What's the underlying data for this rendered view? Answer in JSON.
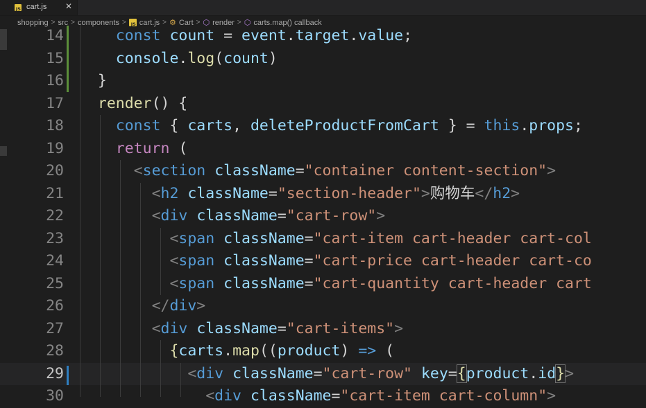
{
  "tab": {
    "badge": "JS",
    "label": "cart.js",
    "close": "✕"
  },
  "breadcrumb": {
    "items": [
      "shopping",
      "src",
      "components",
      "cart.js",
      "Cart",
      "render",
      "carts.map() callback"
    ],
    "sep": ">"
  },
  "editor": {
    "lines": [
      {
        "n": "14",
        "tokens": [
          [
            "",
            "    "
          ],
          [
            "kw",
            "const"
          ],
          [
            "",
            " "
          ],
          [
            "var",
            "count"
          ],
          [
            "p",
            " = "
          ],
          [
            "var",
            "event"
          ],
          [
            "p",
            "."
          ],
          [
            "var",
            "target"
          ],
          [
            "p",
            "."
          ],
          [
            "var",
            "value"
          ],
          [
            "p",
            ";"
          ]
        ]
      },
      {
        "n": "15",
        "tokens": [
          [
            "",
            "    "
          ],
          [
            "var",
            "console"
          ],
          [
            "p",
            "."
          ],
          [
            "fn",
            "log"
          ],
          [
            "p",
            "("
          ],
          [
            "var",
            "count"
          ],
          [
            "p",
            ")"
          ]
        ]
      },
      {
        "n": "16",
        "tokens": [
          [
            "",
            "  "
          ],
          [
            "p",
            "}"
          ]
        ]
      },
      {
        "n": "17",
        "tokens": [
          [
            "",
            "  "
          ],
          [
            "fn",
            "render"
          ],
          [
            "p",
            "() {"
          ]
        ]
      },
      {
        "n": "18",
        "tokens": [
          [
            "",
            "    "
          ],
          [
            "kw",
            "const"
          ],
          [
            "p",
            " { "
          ],
          [
            "var",
            "carts"
          ],
          [
            "p",
            ", "
          ],
          [
            "var",
            "deleteProductFromCart"
          ],
          [
            "p",
            " } = "
          ],
          [
            "kw",
            "this"
          ],
          [
            "p",
            "."
          ],
          [
            "var",
            "props"
          ],
          [
            "p",
            ";"
          ]
        ]
      },
      {
        "n": "19",
        "tokens": [
          [
            "",
            "    "
          ],
          [
            "ctl",
            "return"
          ],
          [
            "p",
            " ("
          ]
        ]
      },
      {
        "n": "20",
        "tokens": [
          [
            "",
            "      "
          ],
          [
            "br",
            "<"
          ],
          [
            "tag",
            "section"
          ],
          [
            "p",
            " "
          ],
          [
            "attr",
            "className"
          ],
          [
            "p",
            "="
          ],
          [
            "str",
            "\"container content-section\""
          ],
          [
            "br",
            ">"
          ]
        ]
      },
      {
        "n": "21",
        "tokens": [
          [
            "",
            "        "
          ],
          [
            "br",
            "<"
          ],
          [
            "tag",
            "h2"
          ],
          [
            "p",
            " "
          ],
          [
            "attr",
            "className"
          ],
          [
            "p",
            "="
          ],
          [
            "str",
            "\"section-header\""
          ],
          [
            "br",
            ">"
          ],
          [
            "cn",
            "购物车"
          ],
          [
            "br",
            "</"
          ],
          [
            "tag",
            "h2"
          ],
          [
            "br",
            ">"
          ]
        ]
      },
      {
        "n": "22",
        "tokens": [
          [
            "",
            "        "
          ],
          [
            "br",
            "<"
          ],
          [
            "tag",
            "div"
          ],
          [
            "p",
            " "
          ],
          [
            "attr",
            "className"
          ],
          [
            "p",
            "="
          ],
          [
            "str",
            "\"cart-row\""
          ],
          [
            "br",
            ">"
          ]
        ]
      },
      {
        "n": "23",
        "tokens": [
          [
            "",
            "          "
          ],
          [
            "br",
            "<"
          ],
          [
            "tag",
            "span"
          ],
          [
            "p",
            " "
          ],
          [
            "attr",
            "className"
          ],
          [
            "p",
            "="
          ],
          [
            "str",
            "\"cart-item cart-header cart-col"
          ]
        ]
      },
      {
        "n": "24",
        "tokens": [
          [
            "",
            "          "
          ],
          [
            "br",
            "<"
          ],
          [
            "tag",
            "span"
          ],
          [
            "p",
            " "
          ],
          [
            "attr",
            "className"
          ],
          [
            "p",
            "="
          ],
          [
            "str",
            "\"cart-price cart-header cart-co"
          ]
        ]
      },
      {
        "n": "25",
        "tokens": [
          [
            "",
            "          "
          ],
          [
            "br",
            "<"
          ],
          [
            "tag",
            "span"
          ],
          [
            "p",
            " "
          ],
          [
            "attr",
            "className"
          ],
          [
            "p",
            "="
          ],
          [
            "str",
            "\"cart-quantity cart-header cart"
          ]
        ]
      },
      {
        "n": "26",
        "tokens": [
          [
            "",
            "        "
          ],
          [
            "br",
            "</"
          ],
          [
            "tag",
            "div"
          ],
          [
            "br",
            ">"
          ]
        ]
      },
      {
        "n": "27",
        "tokens": [
          [
            "",
            "        "
          ],
          [
            "br",
            "<"
          ],
          [
            "tag",
            "div"
          ],
          [
            "p",
            " "
          ],
          [
            "attr",
            "className"
          ],
          [
            "p",
            "="
          ],
          [
            "str",
            "\"cart-items\""
          ],
          [
            "br",
            ">"
          ]
        ]
      },
      {
        "n": "28",
        "tokens": [
          [
            "",
            "          "
          ],
          [
            "fn",
            "{"
          ],
          [
            "var",
            "carts"
          ],
          [
            "p",
            "."
          ],
          [
            "fn",
            "map"
          ],
          [
            "p",
            "(("
          ],
          [
            "var",
            "product"
          ],
          [
            "p",
            ") "
          ],
          [
            "kw",
            "=>"
          ],
          [
            "p",
            " ("
          ]
        ]
      },
      {
        "n": "29",
        "tokens": [
          [
            "",
            "            "
          ],
          [
            "br",
            "<"
          ],
          [
            "tag",
            "div"
          ],
          [
            "p",
            " "
          ],
          [
            "attr",
            "className"
          ],
          [
            "p",
            "="
          ],
          [
            "str",
            "\"cart-row\""
          ],
          [
            "p",
            " "
          ],
          [
            "attr",
            "key"
          ],
          [
            "p",
            "="
          ],
          [
            "fn",
            "{"
          ],
          [
            "var",
            "product"
          ],
          [
            "p",
            "."
          ],
          [
            "var",
            "id"
          ],
          [
            "fn",
            "}"
          ],
          [
            "br",
            ">"
          ]
        ]
      },
      {
        "n": "30",
        "tokens": [
          [
            "",
            "              "
          ],
          [
            "br",
            "<"
          ],
          [
            "tag",
            "div"
          ],
          [
            "p",
            " "
          ],
          [
            "attr",
            "className"
          ],
          [
            "p",
            "="
          ],
          [
            "str",
            "\"cart-item cart-column\""
          ],
          [
            "br",
            ">"
          ]
        ]
      }
    ]
  }
}
